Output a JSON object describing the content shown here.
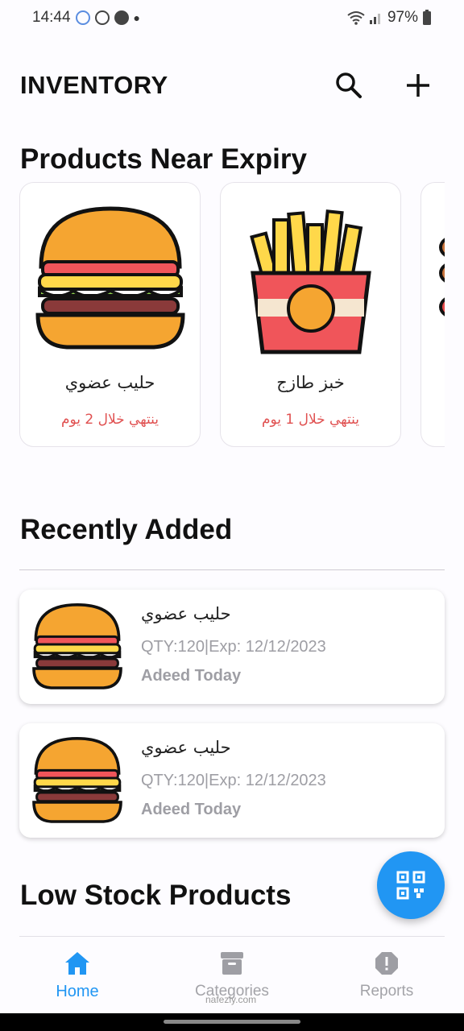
{
  "status_bar": {
    "time": "14:44",
    "battery": "97%"
  },
  "app_bar": {
    "title": "INVENTORY"
  },
  "sections": {
    "near_expiry": "Products Near Expiry",
    "recently_added": "Recently Added",
    "low_stock": "Low Stock Products"
  },
  "near_expiry_items": [
    {
      "name": "حليب عضوي",
      "note": "ينتهي خلال 2 يوم",
      "image": "burger"
    },
    {
      "name": "خبز طازج",
      "note": "ينتهي خلال 1 يوم",
      "image": "fries"
    }
  ],
  "recent_items": [
    {
      "name": "حليب عضوي",
      "meta": "QTY:120|Exp: 12/12/2023",
      "added": "Adeed Today",
      "image": "burger"
    },
    {
      "name": "حليب عضوي",
      "meta": "QTY:120|Exp: 12/12/2023",
      "added": "Adeed Today",
      "image": "burger"
    }
  ],
  "bottom_nav": [
    {
      "label": "Home",
      "icon": "home-icon",
      "active": true
    },
    {
      "label": "Categories",
      "icon": "archive-icon",
      "active": false
    },
    {
      "label": "Reports",
      "icon": "alert-icon",
      "active": false
    }
  ],
  "colors": {
    "accent": "#2196f3",
    "expiry_text": "#e05050",
    "muted": "#9e9ea4"
  },
  "watermark": "nafezly.com"
}
